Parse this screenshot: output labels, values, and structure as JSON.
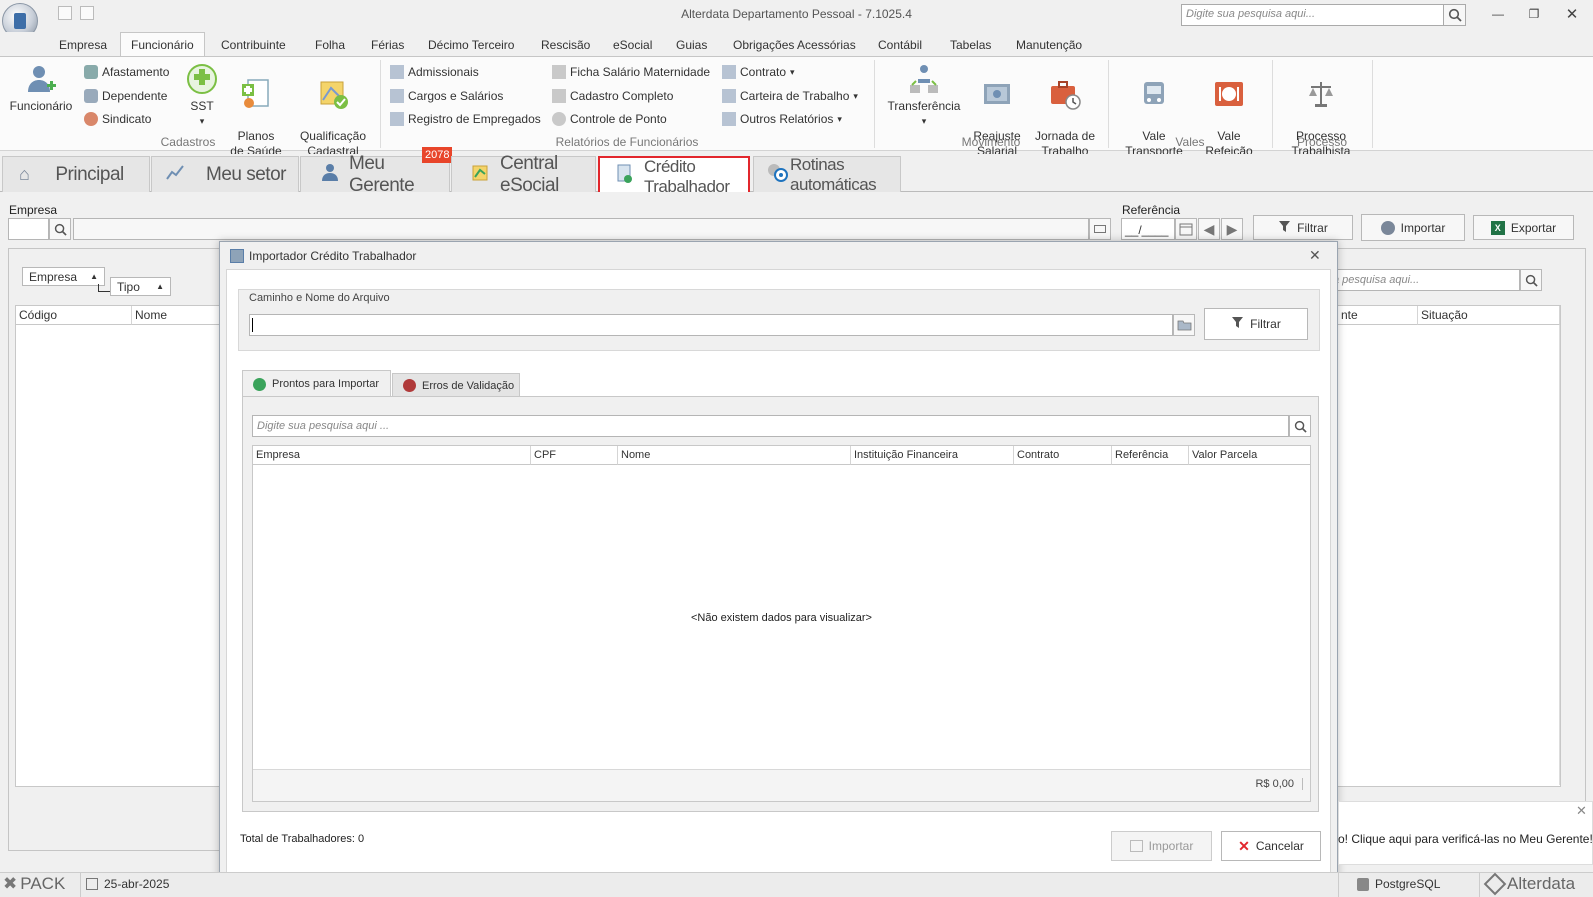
{
  "window": {
    "title": "Alterdata Departamento Pessoal - 7.1025.4",
    "search_placeholder": "Digite sua pesquisa aqui..."
  },
  "menu": [
    "Empresa",
    "Funcionário",
    "Contribuinte",
    "Folha",
    "Férias",
    "Décimo Terceiro",
    "Rescisão",
    "eSocial",
    "Guias",
    "Obrigações Acessórias",
    "Contábil",
    "Tabelas",
    "Manutenção"
  ],
  "ribbon": {
    "cadastros": {
      "funcionario": "Funcionário",
      "afastamento": "Afastamento",
      "dependente": "Dependente",
      "sindicato": "Sindicato",
      "sst": "SST",
      "planos": "Planos\nde Saúde",
      "qualificacao": "Qualificação\nCadastral",
      "label": "Cadastros"
    },
    "relatorios": {
      "admissionais": "Admissionais",
      "cargos": "Cargos e Salários",
      "registro": "Registro de Empregados",
      "ficha": "Ficha Salário Maternidade",
      "cadastro": "Cadastro Completo",
      "controle": "Controle de Ponto",
      "contrato": "Contrato",
      "carteira": "Carteira de Trabalho",
      "outros": "Outros Relatórios",
      "label": "Relatórios de Funcionários"
    },
    "movimento": {
      "transferencia": "Transferência",
      "reajuste": "Reajuste\nSalarial",
      "jornada": "Jornada de\nTrabalho",
      "label": "Movimento"
    },
    "vales": {
      "transporte": "Vale\nTransporte",
      "refeicao": "Vale\nRefeição",
      "label": "Vales"
    },
    "processo": {
      "trabalhista": "Processo\nTrabalhista",
      "label": "Processo"
    }
  },
  "tabs": {
    "principal": "Principal",
    "meu_setor": "Meu setor",
    "meu_gerente": "Meu Gerente",
    "badge": "2078",
    "central": "Central eSocial",
    "credito": "Crédito Trabalhador",
    "rotinas": "Rotinas automáticas"
  },
  "main": {
    "empresa_label": "Empresa",
    "referencia_label": "Referência",
    "referencia_value": "__/____",
    "filtrar": "Filtrar",
    "importar": "Importar",
    "exportar": "Exportar",
    "group_empresa": "Empresa",
    "group_tipo": "Tipo",
    "col_codigo": "Código",
    "col_nome": "Nome",
    "col_ente": "nte",
    "col_situacao": "Situação",
    "search_partial": "a pesquisa aqui..."
  },
  "modal": {
    "title": "Importador Crédito Trabalhador",
    "file_label": "Caminho e Nome do Arquivo",
    "filtrar": "Filtrar",
    "tab_prontos": "Prontos para Importar",
    "tab_erros": "Erros de Validação",
    "search_placeholder": "Digite sua pesquisa aqui ...",
    "columns": [
      "Empresa",
      "CPF",
      "Nome",
      "Instituição Financeira",
      "Contrato",
      "Referência",
      "Valor Parcela"
    ],
    "empty": "<Não existem dados para visualizar>",
    "total_value": "R$ 0,00",
    "total_label": "Total de Trabalhadores: 0",
    "importar": "Importar",
    "cancelar": "Cancelar"
  },
  "notification": {
    "text": "o! Clique aqui para verificá-las no Meu Gerente!"
  },
  "status": {
    "pack": "PACK",
    "date": "25-abr-2025",
    "db": "PostgreSQL",
    "brand": "Alterdata"
  },
  "colors": {
    "accent_red": "#e2262c",
    "green": "#3aa35b",
    "red_dot": "#b03a3a"
  }
}
